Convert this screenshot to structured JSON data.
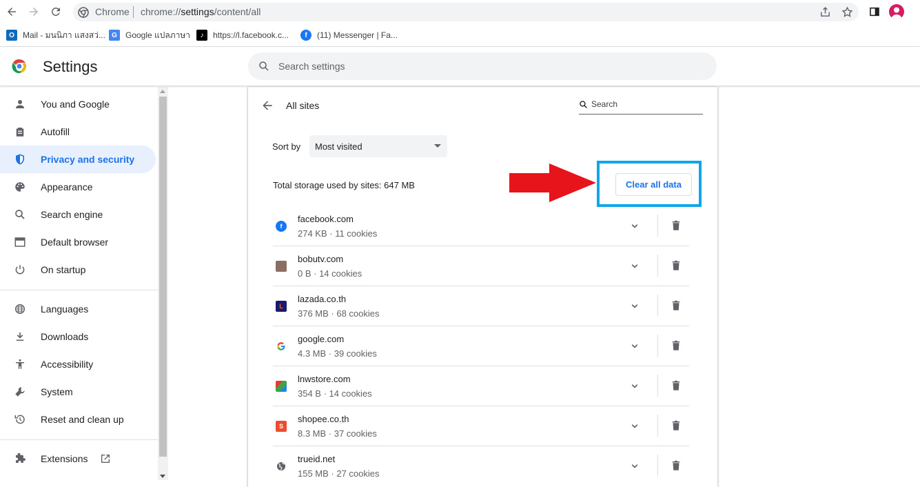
{
  "browser": {
    "omnibox_site_label": "Chrome",
    "url_prefix": "chrome://",
    "url_highlight": "settings",
    "url_suffix": "/content/all"
  },
  "bookmarks": [
    {
      "label": "Mail - มนนิภา แสงสว่...",
      "icon": "outlook-icon",
      "color": "#0f6cbd"
    },
    {
      "label": "Google แปลภาษา",
      "icon": "google-translate-icon",
      "color": "#4285f4"
    },
    {
      "label": "https://l.facebook.c...",
      "icon": "tiktok-icon",
      "color": "#000000"
    },
    {
      "label": "(11) Messenger | Fa...",
      "icon": "facebook-icon",
      "color": "#1877f2"
    }
  ],
  "header": {
    "title": "Settings",
    "search_placeholder": "Search settings"
  },
  "sidebar": {
    "items": [
      {
        "label": "You and Google",
        "icon": "person-icon"
      },
      {
        "label": "Autofill",
        "icon": "clipboard-icon"
      },
      {
        "label": "Privacy and security",
        "icon": "shield-icon",
        "active": true
      },
      {
        "label": "Appearance",
        "icon": "palette-icon"
      },
      {
        "label": "Search engine",
        "icon": "search-icon"
      },
      {
        "label": "Default browser",
        "icon": "browser-icon"
      },
      {
        "label": "On startup",
        "icon": "power-icon"
      },
      {
        "label": "Languages",
        "icon": "globe-icon"
      },
      {
        "label": "Downloads",
        "icon": "download-icon"
      },
      {
        "label": "Accessibility",
        "icon": "accessibility-icon"
      },
      {
        "label": "System",
        "icon": "wrench-icon"
      },
      {
        "label": "Reset and clean up",
        "icon": "restore-icon"
      },
      {
        "label": "Extensions",
        "icon": "puzzle-icon"
      }
    ]
  },
  "main": {
    "title": "All sites",
    "search_placeholder": "Search",
    "sort_label": "Sort by",
    "sort_value": "Most visited",
    "storage_total": "Total storage used by sites: 647 MB",
    "clear_all_label": "Clear all data",
    "sites": [
      {
        "name": "facebook.com",
        "meta": "274 KB · 11 cookies",
        "icon": "facebook-favicon",
        "color": "#1877f2"
      },
      {
        "name": "bobutv.com",
        "meta": "0 B · 14 cookies",
        "icon": "bobutv-favicon",
        "color": "#8d6e63"
      },
      {
        "name": "lazada.co.th",
        "meta": "376 MB · 68 cookies",
        "icon": "lazada-favicon",
        "color": "#1a1a6e"
      },
      {
        "name": "google.com",
        "meta": "4.3 MB · 39 cookies",
        "icon": "google-favicon",
        "color": "#ffffff"
      },
      {
        "name": "lnwstore.com",
        "meta": "354 B · 14 cookies",
        "icon": "lnwstore-favicon",
        "color": "#43a047"
      },
      {
        "name": "shopee.co.th",
        "meta": "8.3 MB · 37 cookies",
        "icon": "shopee-favicon",
        "color": "#ee4d2d"
      },
      {
        "name": "trueid.net",
        "meta": "155 MB · 27 cookies",
        "icon": "globe-favicon",
        "color": "#5f6368"
      }
    ]
  },
  "annotation": {
    "arrow_color": "#e8141c",
    "highlight_color": "#0ea5e9"
  }
}
